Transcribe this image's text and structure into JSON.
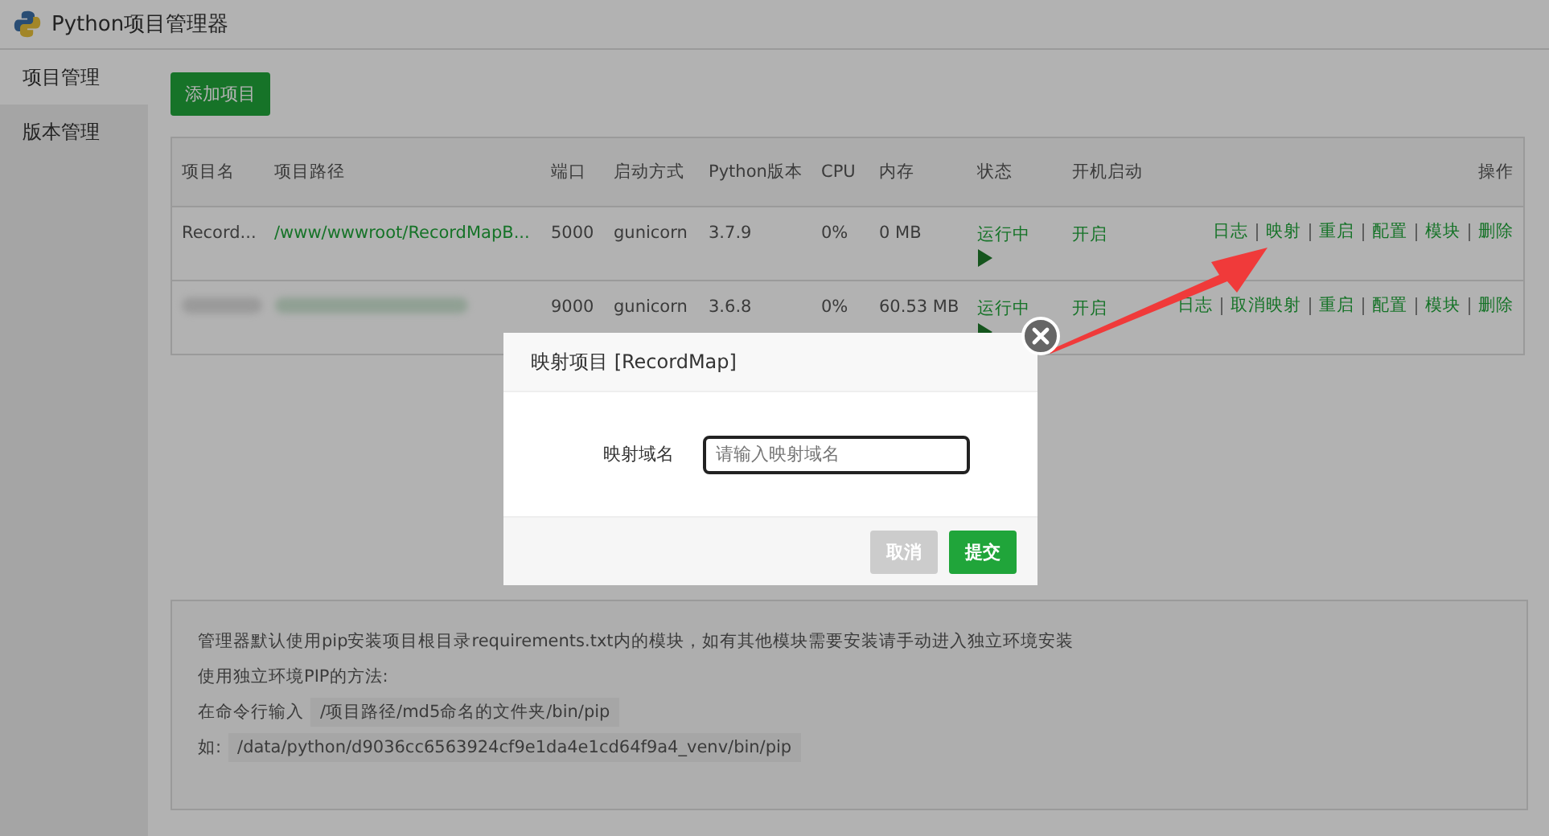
{
  "window": {
    "title": "Python项目管理器"
  },
  "sidebar": {
    "items": [
      {
        "label": "项目管理",
        "selected": true
      },
      {
        "label": "版本管理",
        "selected": false
      }
    ]
  },
  "toolbar": {
    "add_button": "添加项目"
  },
  "table": {
    "columns": [
      "项目名",
      "项目路径",
      "端口",
      "启动方式",
      "Python版本",
      "CPU",
      "内存",
      "状态",
      "开机启动",
      "操作"
    ],
    "rows": [
      {
        "redacted": false,
        "name": "Record...",
        "path": "/www/wwwroot/RecordMapB...",
        "port": "5000",
        "startup": "gunicorn",
        "python": "3.7.9",
        "cpu": "0%",
        "memory": "0 MB",
        "status": "运行中",
        "autostart": "开启",
        "actions": [
          "日志",
          "映射",
          "重启",
          "配置",
          "模块",
          "删除"
        ]
      },
      {
        "redacted": true,
        "port": "9000",
        "startup": "gunicorn",
        "python": "3.6.8",
        "cpu": "0%",
        "memory": "60.53 MB",
        "status": "运行中",
        "autostart": "开启",
        "actions": [
          "日志",
          "取消映射",
          "重启",
          "配置",
          "模块",
          "删除"
        ]
      }
    ]
  },
  "notes": {
    "line1": "管理器默认使用pip安装项目根目录requirements.txt内的模块，如有其他模块需要安装请手动进入独立环境安装",
    "line2": "使用独立环境PIP的方法:",
    "line3_label": "在命令行输入",
    "line3_code": "/项目路径/md5命名的文件夹/bin/pip",
    "line4_label": "如:",
    "line4_code": "/data/python/d9036cc6563924cf9e1da4e1cd64f9a4_venv/bin/pip"
  },
  "dialog": {
    "title": "映射项目 [RecordMap]",
    "field_label": "映射域名",
    "placeholder": "请输入映射域名",
    "cancel": "取消",
    "submit": "提交"
  }
}
